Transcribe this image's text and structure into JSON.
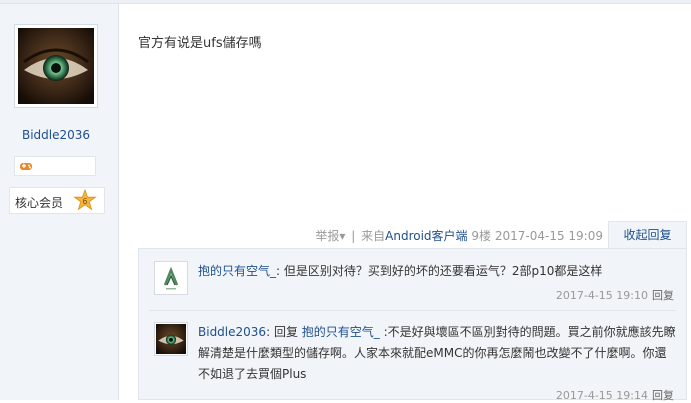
{
  "author": {
    "name": "Biddle2036",
    "medal_icon": "gamepad-icon",
    "group": "核心会员",
    "level": "6"
  },
  "post": {
    "text": "官方有说是ufs儲存嗎"
  },
  "meta": {
    "report": "举报",
    "report_arrow": "▾",
    "separator": "|",
    "from": "来自",
    "client": "Android客户端",
    "floor": "9楼",
    "time": "2017-04-15 19:09",
    "reply_tab": "收起回复"
  },
  "comments": [
    {
      "user": "抱的只有空气_",
      "colon": ":",
      "text": "但是区别对待？买到好的坏的还要看运气？2部p10都是这样",
      "time": "2017-4-15 19:10",
      "reply": "回复"
    },
    {
      "user": "Biddle2036",
      "colon": ":",
      "reply_prefix": "回复",
      "target": "抱的只有空气_",
      "text": ":不是好與壞區不區別對待的問題。買之前你就應該先瞭解清楚是什麼類型的儲存啊。人家本來就配eMMC的你再怎麼鬧也改變不了什麼啊。你還不如退了去買個Plus",
      "time": "2017-4-15 19:14",
      "reply": "回复"
    }
  ],
  "colors": {
    "link": "#1e4f8f",
    "muted": "#999999",
    "sidebar_bg": "#f1f4f8",
    "comment_bg": "#f1f4f8"
  }
}
